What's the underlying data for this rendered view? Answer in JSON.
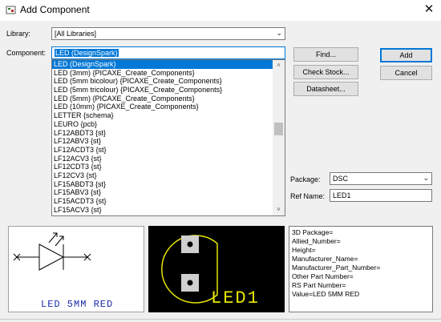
{
  "window": {
    "title": "Add Component",
    "close_glyph": "✕"
  },
  "library": {
    "label": "Library:",
    "value": "[All Libraries]"
  },
  "component": {
    "label": "Component:",
    "value": "LED (DesignSpark)"
  },
  "list": {
    "items": [
      "LED (DesignSpark)",
      "LED (3mm) {PICAXE_Create_Components}",
      "LED (5mm bicolour) {PICAXE_Create_Components}",
      "LED (5mm tricolour) {PICAXE_Create_Components}",
      "LED (5mm) {PICAXE_Create_Components}",
      "LED (10mm) {PICAXE_Create_Components}",
      "LETTER {schema}",
      "LEURO {pcb}",
      "LF12ABDT3 {st}",
      "LF12ABV3 {st}",
      "LF12ACDT3 {st}",
      "LF12ACV3 {st}",
      "LF12CDT3 {st}",
      "LF12CV3 {st}",
      "LF15ABDT3 {st}",
      "LF15ABV3 {st}",
      "LF15ACDT3 {st}",
      "LF15ACV3 {st}"
    ],
    "selected_index": 0
  },
  "buttons": {
    "find": "Find...",
    "check_stock": "Check Stock...",
    "datasheet": "Datasheet...",
    "add": "Add",
    "cancel": "Cancel"
  },
  "package": {
    "label": "Package:",
    "value": "DSC"
  },
  "ref_name": {
    "label": "Ref Name:",
    "value": "LED1"
  },
  "schematic_preview": {
    "caption": "LED 5MM RED"
  },
  "pcb_preview": {
    "caption": "LED1"
  },
  "properties": [
    "3D Package=",
    "Allied_Number=",
    "Height=",
    "Manufacturer_Name=",
    "Manufacturer_Part_Number=",
    "Other Part Number=",
    "RS Part Number=",
    "Value=LED 5MM RED"
  ],
  "colors": {
    "selection": "#0078d7",
    "schematic_text": "#1a2aa8",
    "pcb_outline": "#e6e600"
  }
}
